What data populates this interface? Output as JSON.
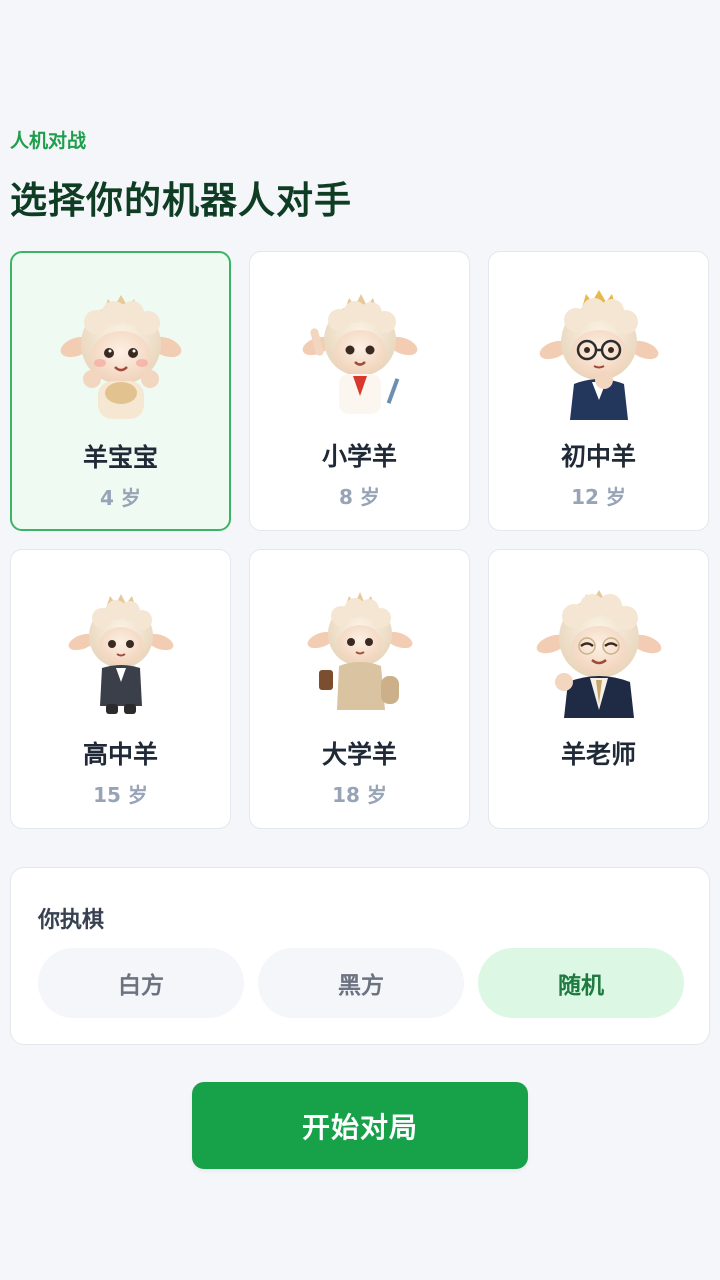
{
  "header": {
    "eyebrow": "人机对战",
    "title": "选择你的机器人对手"
  },
  "opponents": [
    {
      "name": "羊宝宝",
      "age": "4 岁",
      "selected": true,
      "avatar": "baby-sheep-icon"
    },
    {
      "name": "小学羊",
      "age": "8 岁",
      "selected": false,
      "avatar": "pupil-sheep-icon"
    },
    {
      "name": "初中羊",
      "age": "12 岁",
      "selected": false,
      "avatar": "middle-school-sheep-icon"
    },
    {
      "name": "高中羊",
      "age": "15 岁",
      "selected": false,
      "avatar": "high-school-sheep-icon"
    },
    {
      "name": "大学羊",
      "age": "18 岁",
      "selected": false,
      "avatar": "college-sheep-icon"
    },
    {
      "name": "羊老师",
      "age": "",
      "selected": false,
      "avatar": "teacher-sheep-icon"
    }
  ],
  "side_picker": {
    "label": "你执棋",
    "options": [
      "白方",
      "黑方",
      "随机"
    ],
    "selected": "随机"
  },
  "start_button": "开始对局",
  "colors": {
    "accent": "#17a24a",
    "title": "#0e3d24",
    "selected_card_bg": "#effbf2",
    "selected_card_border": "#3bb565",
    "active_option_bg": "#dcf8e4"
  }
}
